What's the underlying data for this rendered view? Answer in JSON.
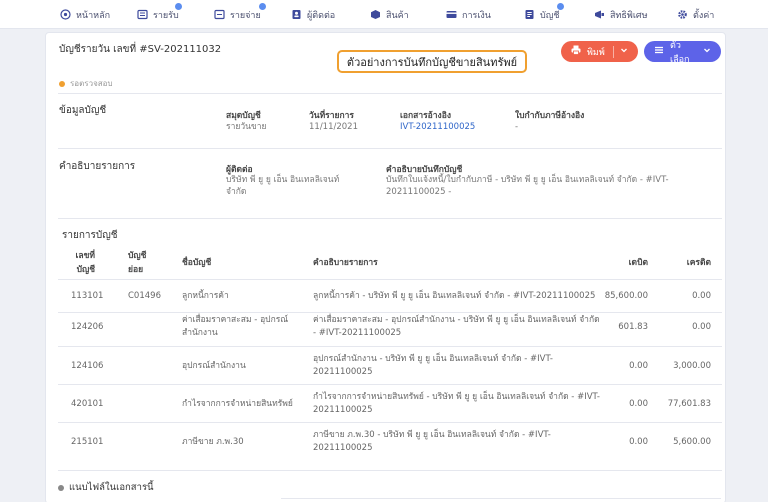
{
  "nav": [
    {
      "label": "หน้าหลัก",
      "icon": "home-icon"
    },
    {
      "label": "รายรับ",
      "icon": "income-icon"
    },
    {
      "label": "รายจ่าย",
      "icon": "expense-icon"
    },
    {
      "label": "ผู้ติดต่อ",
      "icon": "contacts-icon"
    },
    {
      "label": "สินค้า",
      "icon": "product-icon"
    },
    {
      "label": "การเงิน",
      "icon": "finance-icon"
    },
    {
      "label": "บัญชี",
      "icon": "accounting-icon"
    },
    {
      "label": "สิทธิพิเศษ",
      "icon": "privilege-icon"
    },
    {
      "label": "ตั้งค่า",
      "icon": "settings-icon"
    }
  ],
  "header": {
    "title": "บัญชีรายวัน เลขที่ #SV-202111032",
    "status": "รอตรวจสอบ",
    "callout": "ตัวอย่างการบันทึกบัญชีขายสินทรัพย์",
    "print_label": "พิมพ์",
    "options_label": "ตัวเลือก"
  },
  "colors": {
    "print": "#f0624a",
    "options": "#5d63e8",
    "status": "#f0a030",
    "link": "#2f66c9"
  },
  "info": {
    "section_title": "ข้อมูลบัญชี",
    "journal_label": "สมุดบัญชี",
    "journal_value": "รายวันขาย",
    "date_label": "วันที่รายการ",
    "date_value": "11/11/2021",
    "ref_label": "เอกสารอ้างอิง",
    "ref_value": "IVT-20211100025",
    "tax_label": "ใบกำกับภาษีอ้างอิง",
    "tax_value": "-"
  },
  "desc": {
    "section_title": "คำอธิบายรายการ",
    "contact_label": "ผู้ติดต่อ",
    "contact_line1": "บริษัท พี ยู ยู เอ็น อินเทลลิเจนท์",
    "contact_line2": "จำกัด",
    "note_label": "คำอธิบายบันทึกบัญชี",
    "note_line1": "บันทึกใบแจ้งหนี้/ใบกำกับภาษี - บริษัท พี ยู ยู เอ็น อินเทลลิเจนท์ จำกัด - #IVT-",
    "note_line2": "20211100025 -"
  },
  "table": {
    "section_title": "รายการบัญชี",
    "headers": {
      "acc_no_1": "เลขที่",
      "acc_no_2": "บัญชี",
      "sub_1": "บัญชี",
      "sub_2": "ย่อย",
      "name": "ชื่อบัญชี",
      "desc": "คำอธิบายรายการ",
      "debit": "เดบิต",
      "credit": "เครดิต"
    },
    "rows": [
      {
        "no": "113101",
        "sub": "C01496",
        "name1": "ลูกหนี้การค้า",
        "name2": "",
        "desc1": "ลูกหนี้การค้า - บริษัท พี ยู ยู เอ็น อินเทลลิเจนท์ จำกัด - #IVT-20211100025",
        "desc2": "",
        "debit": "85,600.00",
        "credit": "0.00"
      },
      {
        "no": "124206",
        "sub": "",
        "name1": "ค่าเสื่อมราคาสะสม - อุปกรณ์",
        "name2": "สำนักงาน",
        "desc1": "ค่าเสื่อมราคาสะสม - อุปกรณ์สำนักงาน - บริษัท พี ยู ยู เอ็น อินเทลลิเจนท์ จำกัด",
        "desc2": "- #IVT-20211100025",
        "debit": "601.83",
        "credit": "0.00"
      },
      {
        "no": "124106",
        "sub": "",
        "name1": "อุปกรณ์สำนักงาน",
        "name2": "",
        "desc1": "อุปกรณ์สำนักงาน - บริษัท พี ยู ยู เอ็น อินเทลลิเจนท์ จำกัด - #IVT-",
        "desc2": "20211100025",
        "debit": "0.00",
        "credit": "3,000.00"
      },
      {
        "no": "420101",
        "sub": "",
        "name1": "กำไรจากการจำหน่ายสินทรัพย์",
        "name2": "",
        "desc1": "กำไรจากการจำหน่ายสินทรัพย์ - บริษัท พี ยู ยู เอ็น อินเทลลิเจนท์ จำกัด - #IVT-",
        "desc2": "20211100025",
        "debit": "0.00",
        "credit": "77,601.83"
      },
      {
        "no": "215101",
        "sub": "",
        "name1": "ภาษีขาย ภ.พ.30",
        "name2": "",
        "desc1": "ภาษีขาย ภ.พ.30 - บริษัท พี ยู ยู เอ็น อินเทลลิเจนท์ จำกัด - #IVT-",
        "desc2": "20211100025",
        "debit": "0.00",
        "credit": "5,600.00"
      }
    ]
  },
  "attachments": {
    "title": "แนบไฟล์ในเอกสารนี้"
  }
}
